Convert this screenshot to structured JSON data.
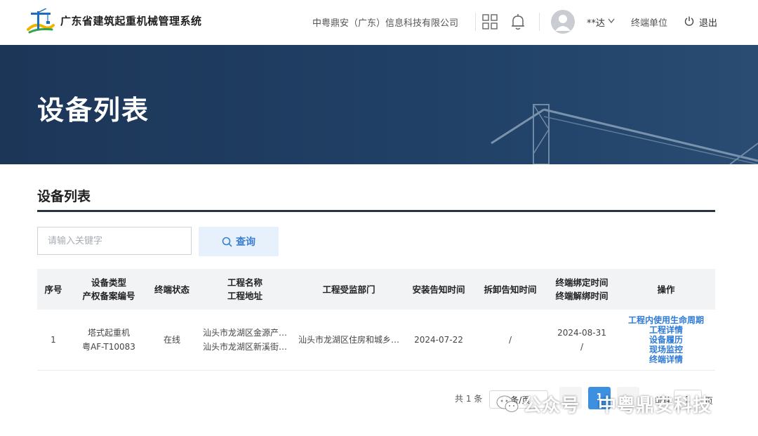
{
  "header": {
    "system_title": "广东省建筑起重机械管理系统",
    "company": "中粤鼎安（广东）信息科技有限公司",
    "username": "**达",
    "terminal_unit": "终端单位",
    "logout": "退出"
  },
  "banner": {
    "title": "设备列表"
  },
  "section": {
    "title": "设备列表"
  },
  "search": {
    "placeholder": "请输入关键字",
    "button_label": "查询"
  },
  "table": {
    "headers": {
      "index": "序号",
      "device_type": "设备类型",
      "record_no": "产权备案编号",
      "terminal_status": "终端状态",
      "project_name": "工程名称",
      "project_address": "工程地址",
      "supervision_dept": "工程受监部门",
      "install_notice_time": "安装告知时间",
      "dismantle_notice_time": "拆卸告知时间",
      "bind_time": "终端绑定时间",
      "unbind_time": "终端解绑时间",
      "actions": "操作"
    },
    "rows": [
      {
        "index": "1",
        "device_type": "塔式起重机",
        "record_no": "粤AF-T10083",
        "terminal_status": "在线",
        "project_name": "汕头市龙湖区金源产…",
        "project_address": "汕头市龙湖区新溪街…",
        "supervision_dept": "汕头市龙湖区住房和城乡…",
        "install_notice_time": "2024-07-22",
        "dismantle_notice_time": "/",
        "bind_time": "2024-08-31",
        "unbind_time": "/",
        "actions": [
          "工程内使用生命周期",
          "工程详情",
          "设备履历",
          "现场监控",
          "终端详情"
        ]
      }
    ]
  },
  "pagination": {
    "total": "共 1 条",
    "page_size": "10条/页",
    "current_page": "1",
    "goto_label": "前往",
    "goto_value": "1",
    "goto_suffix": "页"
  },
  "watermark": {
    "platform": "公众号",
    "name": "中粤鼎安科技"
  },
  "colors": {
    "banner_bg": "#1e3b5e",
    "accent": "#3d8fe0",
    "link": "#2e7bd6",
    "search_btn_bg": "#e7f1fb"
  }
}
